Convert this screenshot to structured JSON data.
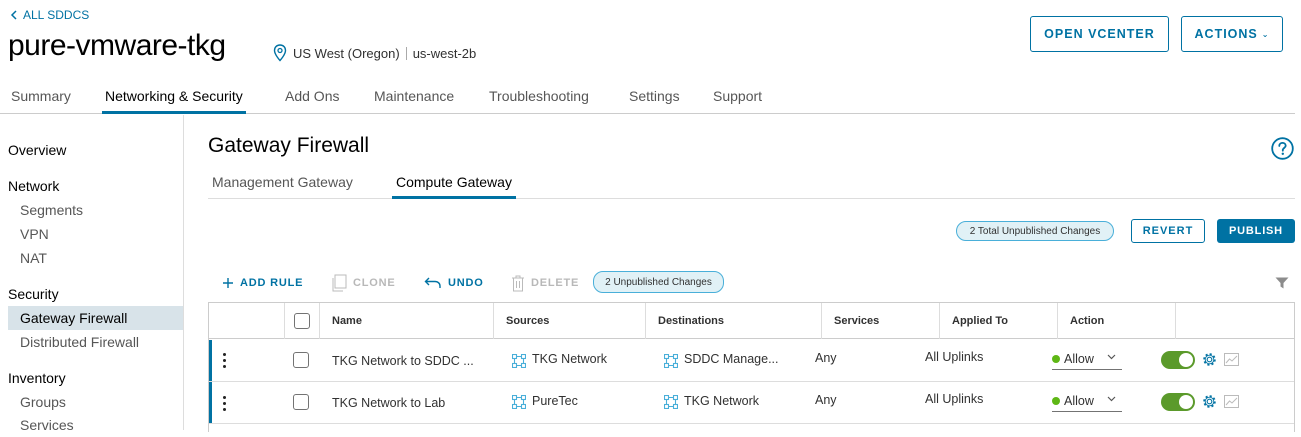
{
  "header": {
    "back_label": "ALL SDDCS",
    "title": "pure-vmware-tkg",
    "region": "US West (Oregon)",
    "zone": "us-west-2b",
    "open_vcenter_label": "OPEN VCENTER",
    "actions_label": "ACTIONS"
  },
  "tabs": [
    {
      "label": "Summary"
    },
    {
      "label": "Networking & Security",
      "active": true
    },
    {
      "label": "Add Ons"
    },
    {
      "label": "Maintenance"
    },
    {
      "label": "Troubleshooting"
    },
    {
      "label": "Settings"
    },
    {
      "label": "Support"
    }
  ],
  "sidebar": {
    "overview": "Overview",
    "network_heading": "Network",
    "network_items": [
      "Segments",
      "VPN",
      "NAT"
    ],
    "security_heading": "Security",
    "security_items": [
      "Gateway Firewall",
      "Distributed Firewall"
    ],
    "inventory_heading": "Inventory",
    "inventory_items": [
      "Groups",
      "Services"
    ]
  },
  "main": {
    "title": "Gateway Firewall",
    "subtabs": [
      {
        "label": "Management Gateway"
      },
      {
        "label": "Compute Gateway",
        "active": true
      }
    ],
    "total_changes_badge": "2 Total Unpublished Changes",
    "revert_label": "REVERT",
    "publish_label": "PUBLISH",
    "toolbar": {
      "add_rule": "ADD RULE",
      "clone": "CLONE",
      "undo": "UNDO",
      "delete": "DELETE",
      "unpublished_badge": "2 Unpublished Changes"
    }
  },
  "grid": {
    "columns": [
      "Name",
      "Sources",
      "Destinations",
      "Services",
      "Applied To",
      "Action"
    ],
    "rows": [
      {
        "name": "TKG Network to SDDC ...",
        "source": "TKG Network",
        "destination": "SDDC Manage...",
        "services": "Any",
        "applied_to": "All Uplinks",
        "action": "Allow",
        "enabled": true
      },
      {
        "name": "TKG Network to Lab",
        "source": "PureTec",
        "destination": "TKG Network",
        "services": "Any",
        "applied_to": "All Uplinks",
        "action": "Allow",
        "enabled": true
      }
    ]
  },
  "colors": {
    "accent": "#0072a3",
    "allow": "#5eb715",
    "toggle_on": "#5b9a2b",
    "badge_bg": "#e1f1f6"
  }
}
